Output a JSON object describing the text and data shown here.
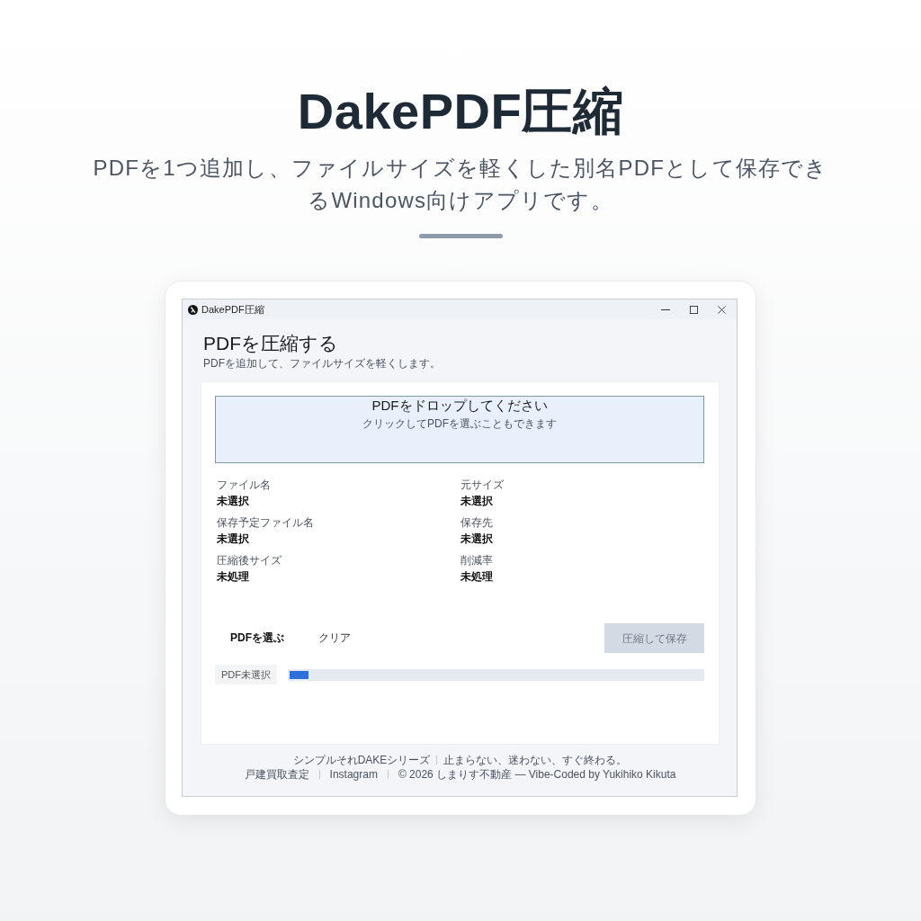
{
  "hero": {
    "title": "DakePDF圧縮",
    "description": "PDFを1つ追加し、ファイルサイズを軽くした別名PDFとして保存できるWindows向けアプリです。"
  },
  "window": {
    "title": "DakePDF圧縮"
  },
  "app": {
    "heading": "PDFを圧縮する",
    "subheading": "PDFを追加して、ファイルサイズを軽くします。",
    "dropzone": {
      "title": "PDFをドロップしてください",
      "hint": "クリックしてPDFを選ぶこともできます"
    },
    "fields": [
      {
        "label": "ファイル名",
        "value": "未選択"
      },
      {
        "label": "元サイズ",
        "value": "未選択"
      },
      {
        "label": "保存予定ファイル名",
        "value": "未選択"
      },
      {
        "label": "保存先",
        "value": "未選択"
      },
      {
        "label": "圧縮後サイズ",
        "value": "未処理"
      },
      {
        "label": "削減率",
        "value": "未処理"
      }
    ],
    "actions": [
      {
        "label": "PDFを選ぶ",
        "kind": "strong",
        "disabled": false
      },
      {
        "label": "クリア",
        "kind": "plain",
        "disabled": false
      },
      {
        "label": "圧縮して保存",
        "kind": "primary",
        "disabled": true
      }
    ],
    "status": {
      "text": "PDF未選択"
    },
    "progress": {
      "level": 0.045
    }
  },
  "footer": {
    "tagline": [
      "シンプルそれDAKEシリーズ",
      "止まらない、迷わない、すぐ終わる。"
    ],
    "links": [
      "戸建買取査定",
      "Instagram"
    ],
    "copyright": "© 2026 しまりす不動産 — Vibe-Coded by Yukihiko Kikuta"
  }
}
